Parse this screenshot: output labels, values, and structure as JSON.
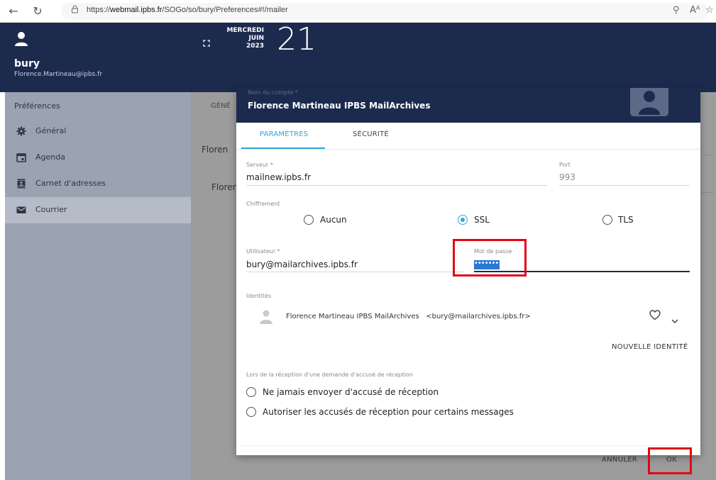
{
  "browser": {
    "url_prefix": "https://",
    "url_host": "webmail.ipbs.fr",
    "url_path": "/SOGo/so/bury/Preferences#!/mailer"
  },
  "header": {
    "username": "bury",
    "email": "Florence.Martineau@ipbs.fr",
    "weekday": "MERCREDI",
    "month": "JUIN",
    "year": "2023",
    "day": "21"
  },
  "sidebar": {
    "title": "Préférences",
    "items": [
      {
        "label": "Général",
        "icon": "gear-icon"
      },
      {
        "label": "Agenda",
        "icon": "calendar-icon"
      },
      {
        "label": "Carnet d'adresses",
        "icon": "contacts-icon"
      },
      {
        "label": "Courrier",
        "icon": "mail-icon"
      }
    ]
  },
  "background": {
    "tab_partial": "GÉNÉ",
    "field1_partial": "Floren",
    "field2_partial": "Floren"
  },
  "dialog": {
    "subtitle": "Nom du compte *",
    "title": "Florence Martineau IPBS MailArchives",
    "tabs": [
      {
        "label": "PARAMÈTRES",
        "active": true
      },
      {
        "label": "SÉCURITÉ",
        "active": false
      }
    ],
    "server": {
      "label": "Serveur *",
      "value": "mailnew.ipbs.fr"
    },
    "port": {
      "label": "Port",
      "value": "993"
    },
    "encryption": {
      "label": "Chiffrement",
      "options": [
        {
          "label": "Aucun",
          "selected": false
        },
        {
          "label": "SSL",
          "selected": true
        },
        {
          "label": "TLS",
          "selected": false
        }
      ]
    },
    "user": {
      "label": "Utilisateur *",
      "value": "bury@mailarchives.ipbs.fr"
    },
    "password": {
      "label": "Mot de passe",
      "value": "••••••••••"
    },
    "identities": {
      "label": "Identités",
      "name": "Florence Martineau IPBS MailArchives",
      "email": "<bury@mailarchives.ipbs.fr>",
      "new_button": "NOUVELLE IDENTITÉ"
    },
    "receipt": {
      "label": "Lors de la réception d'une demande d'accusé de réception",
      "options": [
        {
          "label": "Ne jamais envoyer d'accusé de réception"
        },
        {
          "label": "Autoriser les accusés de réception pour certains messages"
        }
      ]
    },
    "cancel": "ANNULER",
    "ok": "OK"
  },
  "colors": {
    "header": "#1c2a4e",
    "accent": "#2fa8d8",
    "highlight": "#e30613"
  }
}
